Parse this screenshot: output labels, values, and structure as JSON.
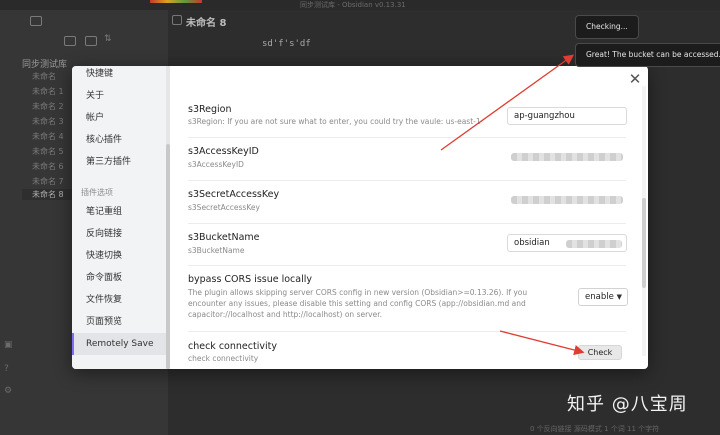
{
  "window": {
    "title": "同步测试库 - Obsidian v0.13.31"
  },
  "file_explorer": {
    "vault_name": "同步测试库",
    "files": [
      "未命名",
      "未命名 1",
      "未命名 2",
      "未命名 3",
      "未命名 4",
      "未命名 5",
      "未命名 6",
      "未命名 7",
      "未命名 8"
    ],
    "active_file": "未命名 8"
  },
  "editor": {
    "note_title": "未命名 8",
    "note_body": "sd'f's'df"
  },
  "status_bar": {
    "text": "0 个反向链接  源码模式  1 个词  11 个字符"
  },
  "settings_modal": {
    "sidebar": {
      "items_core": [
        "快捷键",
        "关于",
        "帐户",
        "核心插件",
        "第三方插件"
      ],
      "section_label": "插件选项",
      "items_plugins": [
        "笔记重组",
        "反向链接",
        "快速切换",
        "命令面板",
        "文件恢复",
        "页面预览",
        "Remotely Save"
      ],
      "active_item": "Remotely Save"
    },
    "settings": {
      "region": {
        "name": "s3Region",
        "desc": "s3Region: If you are not sure what to enter, you could try the vaule: us-east-1",
        "value": "ap-guangzhou"
      },
      "access_key": {
        "name": "s3AccessKeyID",
        "desc": "s3AccessKeyID"
      },
      "secret_key": {
        "name": "s3SecretAccessKey",
        "desc": "s3SecretAccessKey"
      },
      "bucket": {
        "name": "s3BucketName",
        "desc": "s3BucketName",
        "value": "obsidian"
      },
      "cors": {
        "name": "bypass CORS issue locally",
        "desc": "The plugin allows skipping server CORS config in new version (Obsidian>=0.13.26). If you encounter any issues, please disable this setting and config CORS (app://obsidian.md and capacitor://localhost and http://localhost) on server.",
        "value": "enable"
      },
      "connectivity": {
        "name": "check connectivity",
        "desc": "check connectivity",
        "button_label": "Check"
      }
    },
    "close_icon": "close-icon"
  },
  "notices": {
    "checking": "Checking...",
    "success": "Great! The bucket can be accessed."
  },
  "watermark": "知乎 @八宝周",
  "colors": {
    "accent": "#7f6df2",
    "annotation_arrow": "#e03c31",
    "notice_bg": "#1c1c1c"
  }
}
